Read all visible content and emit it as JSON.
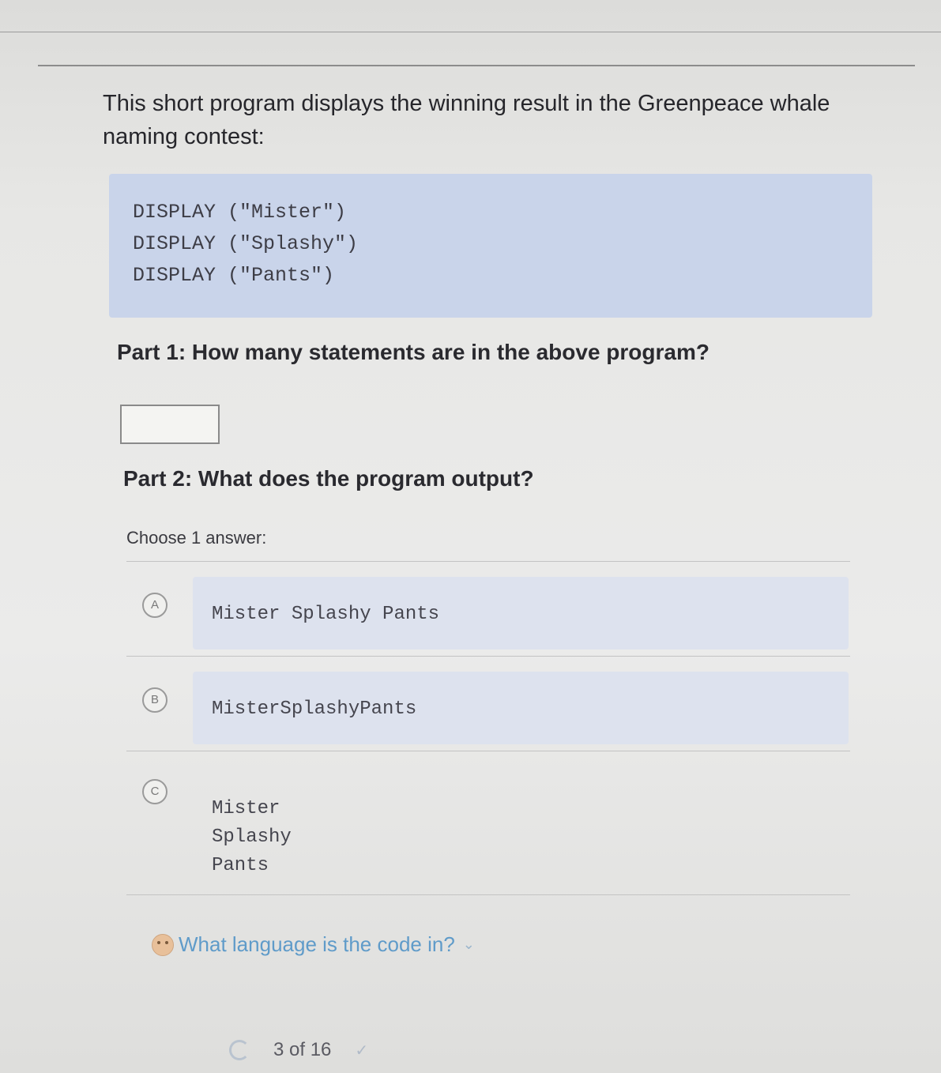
{
  "question": {
    "intro": "This short program displays the winning result in the Greenpeace whale naming contest:",
    "code_lines": [
      "DISPLAY (\"Mister\")",
      "DISPLAY (\"Splashy\")",
      "DISPLAY (\"Pants\")"
    ],
    "part1": "Part 1: How many statements are in the above program?",
    "part1_value": "",
    "part2": "Part 2: What does the program output?",
    "choose_label": "Choose 1 answer:"
  },
  "choices": [
    {
      "letter": "A",
      "lines": [
        "Mister Splashy Pants"
      ]
    },
    {
      "letter": "B",
      "lines": [
        "MisterSplashyPants"
      ]
    },
    {
      "letter": "C",
      "lines": [
        "Mister",
        "Splashy",
        "Pants"
      ]
    }
  ],
  "hint": {
    "text": "What language is the code in?",
    "icon": "hint-face-icon",
    "chevron": "chevron-down-icon"
  },
  "footer": {
    "progress": "3 of 16",
    "reload_icon": "reload-icon",
    "check_icon": "check-icon"
  }
}
